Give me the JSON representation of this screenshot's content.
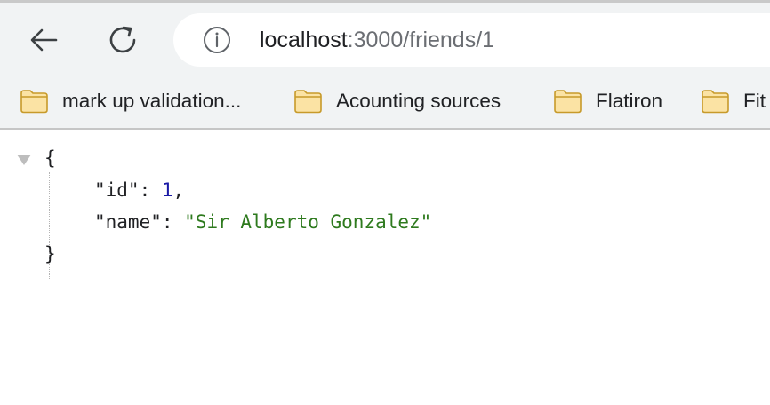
{
  "toolbar": {
    "back_icon": "arrow-left-icon",
    "reload_icon": "reload-icon",
    "info_icon": "info-icon",
    "url": {
      "host": "localhost",
      "path": ":3000/friends/1"
    }
  },
  "bookmarks": [
    {
      "label": "mark up validation...",
      "icon": "folder-icon"
    },
    {
      "label": "Acounting sources",
      "icon": "folder-icon"
    },
    {
      "label": "Flatiron",
      "icon": "folder-icon"
    },
    {
      "label": "Fit",
      "icon": "folder-icon"
    }
  ],
  "json_view": {
    "open_brace": "{",
    "close_brace": "}",
    "entries": [
      {
        "key": "\"id\"",
        "value": "1",
        "value_type": "number",
        "trailing": ","
      },
      {
        "key": "\"name\"",
        "value": "\"Sir Alberto Gonzalez\"",
        "value_type": "string",
        "trailing": ""
      }
    ]
  },
  "colors": {
    "chrome_bg": "#f1f3f4",
    "number": "#1a1aa6",
    "string": "#2e7a1e",
    "folder_fill": "#fbe3a4",
    "folder_stroke": "#c79a2a"
  }
}
